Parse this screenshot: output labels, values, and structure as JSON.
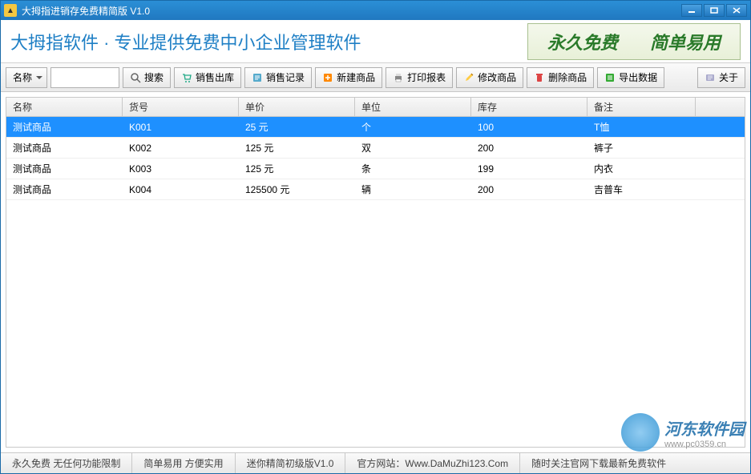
{
  "window": {
    "title": "大拇指进销存免费精简版 V1.0"
  },
  "header": {
    "title": "大拇指软件 · 专业提供免费中小企业管理软件",
    "banner1": "永久免费",
    "banner2": "简单易用"
  },
  "toolbar": {
    "filter_label": "名称",
    "search_value": "",
    "search": "搜索",
    "out": "销售出库",
    "record": "销售记录",
    "new": "新建商品",
    "print": "打印报表",
    "edit": "修改商品",
    "delete": "删除商品",
    "export": "导出数据",
    "about": "关于"
  },
  "table": {
    "headers": [
      "名称",
      "货号",
      "单价",
      "单位",
      "库存",
      "备注"
    ],
    "rows": [
      {
        "name": "测试商品",
        "code": "K001",
        "price": "25 元",
        "unit": "个",
        "stock": "100",
        "note": "T恤",
        "selected": true
      },
      {
        "name": "测试商品",
        "code": "K002",
        "price": "125 元",
        "unit": "双",
        "stock": "200",
        "note": "裤子",
        "selected": false
      },
      {
        "name": "测试商品",
        "code": "K003",
        "price": "125 元",
        "unit": "条",
        "stock": "199",
        "note": "内衣",
        "selected": false
      },
      {
        "name": "测试商品",
        "code": "K004",
        "price": "125500 元",
        "unit": "辆",
        "stock": "200",
        "note": "吉普车",
        "selected": false
      }
    ]
  },
  "status": {
    "s1": "永久免费 无任何功能限制",
    "s2": "简单易用 方便实用",
    "s3": "迷你精简初级版V1.0",
    "s4": "官方网站：Www.DaMuZhi123.Com",
    "s5": "随时关注官网下载最新免费软件"
  },
  "watermark": {
    "text": "河东软件园",
    "url": "www.pc0359.cn"
  }
}
